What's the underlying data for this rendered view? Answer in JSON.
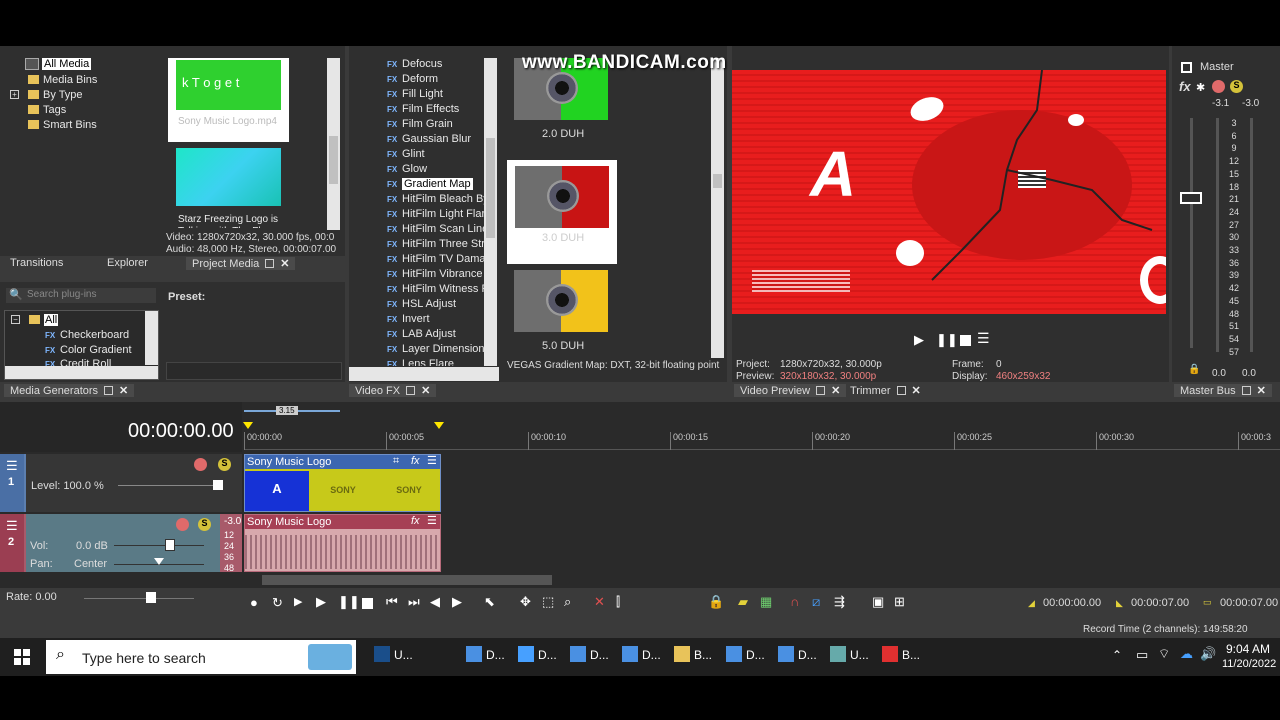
{
  "watermark": "www.BANDICAM.com",
  "explorer": {
    "tree": [
      "All Media",
      "Media Bins",
      "By Type",
      "Tags",
      "Smart Bins"
    ],
    "media": [
      {
        "name": "Sony Music Logo.mp4",
        "thumb_text": "k T o g e t"
      },
      {
        "name": "Starz Freezing Logo is Talking with The Fl..."
      }
    ],
    "info_video": "Video: 1280x720x32, 30.000 fps, 00:0",
    "info_audio": "Audio: 48,000 Hz, Stereo, 00:00:07.00",
    "tabs": [
      "Transitions",
      "Explorer",
      "Project Media"
    ]
  },
  "generators": {
    "search_placeholder": "Search plug-ins",
    "preset_label": "Preset:",
    "tree": [
      "All",
      "Checkerboard",
      "Color Gradient",
      "Credit Roll"
    ],
    "tab": "Media Generators"
  },
  "video_fx": {
    "items": [
      "Defocus",
      "Deform",
      "Fill Light",
      "Film Effects",
      "Film Grain",
      "Gaussian Blur",
      "Glint",
      "Glow",
      "Gradient Map",
      "HitFilm Bleach By",
      "HitFilm Light Flare",
      "HitFilm Scan Lines",
      "HitFilm Three Stri",
      "HitFilm TV Damag",
      "HitFilm Vibrance",
      "HitFilm Witness P",
      "HSL Adjust",
      "Invert",
      "LAB Adjust",
      "Layer Dimensiona",
      "Lens Flare"
    ],
    "selected": "Gradient Map",
    "presets": [
      {
        "label": "2.0 DUH",
        "color": "#21d321"
      },
      {
        "label": "3.0 DUH",
        "color": "#c81414"
      },
      {
        "label": "5.0 DUH",
        "color": "#f2c21a"
      }
    ],
    "status": "VEGAS Gradient Map: DXT, 32-bit floating point",
    "tab": "Video FX"
  },
  "preview": {
    "project_label": "Project:",
    "project_value": "1280x720x32, 30.000p",
    "preview_label": "Preview:",
    "preview_value": "320x180x32, 30.000p",
    "frame_label": "Frame:",
    "frame_value": "0",
    "display_label": "Display:",
    "display_value": "460x259x32",
    "tabs": [
      "Video Preview",
      "Trimmer"
    ],
    "overlay_letter": "A",
    "bg_color": "#e81d1d"
  },
  "master": {
    "title": "Master",
    "fx_label": "fx",
    "peak_left": "-3.1",
    "peak_right": "-3.0",
    "scale": [
      "3",
      "6",
      "9",
      "12",
      "15",
      "18",
      "21",
      "24",
      "27",
      "30",
      "33",
      "36",
      "39",
      "42",
      "45",
      "48",
      "51",
      "54",
      "57"
    ],
    "bottom_left": "0.0",
    "bottom_right": "0.0",
    "tab": "Master Bus"
  },
  "timeline": {
    "timecode": "00:00:00.00",
    "loop_marker": "3.15",
    "ruler": [
      "00:00:00",
      "00:00:05",
      "00:00:10",
      "00:00:15",
      "00:00:20",
      "00:00:25",
      "00:00:30",
      "00:00:3"
    ],
    "track1": {
      "number": "1",
      "level_label": "Level: 100.0 %",
      "clip_name": "Sony Music Logo",
      "frame_labels": [
        "A",
        "SONY",
        "SONY"
      ]
    },
    "track2": {
      "number": "2",
      "vol_label": "Vol:",
      "vol_value": "0.0 dB",
      "pan_label": "Pan:",
      "pan_value": "Center",
      "meter_top": "-3.0",
      "meter_scale": [
        "12",
        "24",
        "36",
        "48"
      ],
      "clip_name": "Sony Music Logo"
    },
    "rate": "Rate: 0.00",
    "time_start": "00:00:00.00",
    "time_end": "00:00:07.00",
    "time_length": "00:00:07.00",
    "record_time": "Record Time (2 channels): 149:58:20"
  },
  "taskbar": {
    "search_placeholder": "Type here to search",
    "apps": [
      "U...",
      "D...",
      "D...",
      "D...",
      "D...",
      "B...",
      "D...",
      "D...",
      "U...",
      "B..."
    ],
    "time": "9:04 AM",
    "date": "11/20/2022"
  }
}
